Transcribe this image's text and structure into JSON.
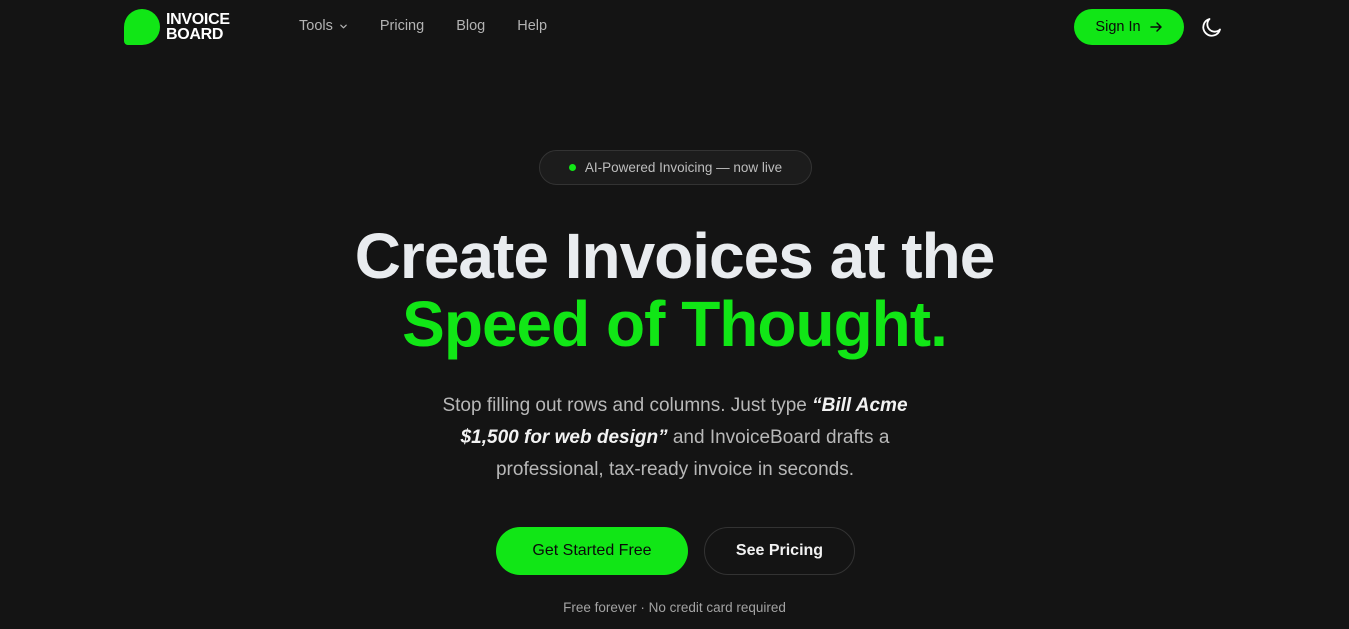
{
  "brand": {
    "line1": "INVOICE",
    "line2": "BOARD",
    "accent": "#11e616"
  },
  "nav": {
    "items": [
      {
        "label": "Tools",
        "has_dropdown": true
      },
      {
        "label": "Pricing"
      },
      {
        "label": "Blog"
      },
      {
        "label": "Help"
      }
    ],
    "sign_in_label": "Sign In",
    "sign_in_icon": "arrow-right-icon",
    "theme_icon": "moon-icon"
  },
  "hero": {
    "badge": "AI-Powered Invoicing — now live",
    "headline_line1": "Create Invoices at the",
    "headline_line2": "Speed of Thought.",
    "sub_before": "Stop filling out rows and columns. Just type ",
    "sub_quote": "“Bill Acme $1,500 for web design”",
    "sub_after": " and InvoiceBoard drafts a professional, tax-ready invoice in seconds.",
    "cta_primary": "Get Started Free",
    "cta_secondary": "See Pricing",
    "fineprint": "Free forever · No credit card required"
  }
}
